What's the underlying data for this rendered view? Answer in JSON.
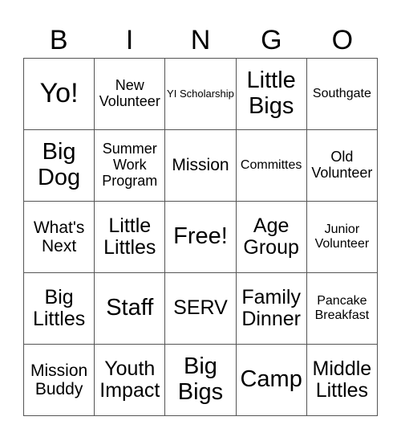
{
  "header": {
    "letters": [
      "B",
      "I",
      "N",
      "G",
      "O"
    ]
  },
  "board": {
    "rows": [
      [
        "Yo!",
        "New Volunteer",
        "YI Scholarship",
        "Little Bigs",
        "Southgate"
      ],
      [
        "Big Dog",
        "Summer Work Program",
        "Mission",
        "Committes",
        "Old Volunteer"
      ],
      [
        "What's Next",
        "Little Littles",
        "Free!",
        "Age Group",
        "Junior Volunteer"
      ],
      [
        "Big Littles",
        "Staff",
        "SERV",
        "Family Dinner",
        "Pancake Breakfast"
      ],
      [
        "Mission Buddy",
        "Youth Impact",
        "Big Bigs",
        "Camp",
        "Middle Littles"
      ]
    ],
    "free_space": "Free!"
  },
  "colors": {
    "text": "#000000",
    "grid_line": "#555555",
    "background": "#ffffff"
  }
}
